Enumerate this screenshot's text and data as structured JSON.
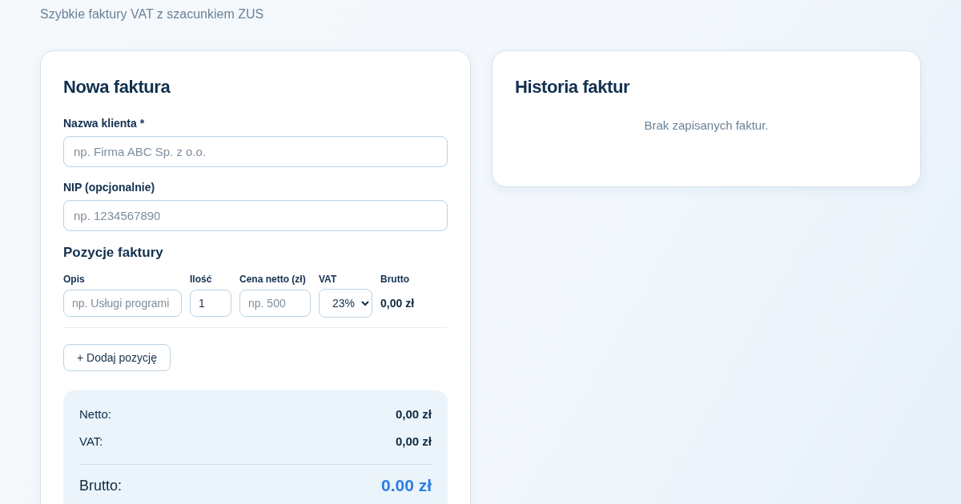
{
  "subtitle": "Szybkie faktury VAT z szacunkiem ZUS",
  "invoice_form": {
    "title": "Nowa faktura",
    "fields": [
      {
        "label": "Nazwa klienta *",
        "placeholder": "np. Firma ABC Sp. z o.o."
      },
      {
        "label": "NIP (opcjonalnie)",
        "placeholder": "np. 1234567890"
      }
    ],
    "items_title": "Pozycje faktury",
    "item_columns": [
      "Opis",
      "Ilość",
      "Cena netto (zł)",
      "VAT",
      "Brutto"
    ],
    "items": [
      {
        "description_placeholder": "np. Usługi programi",
        "quantity": "1",
        "price_placeholder": "np. 500",
        "vat": "23%",
        "gross": "0,00 zł"
      }
    ],
    "add_button": "+ Dodaj pozycję",
    "totals": [
      {
        "label": "Netto:",
        "value": "0,00 zł"
      },
      {
        "label": "VAT:",
        "value": "0,00 zł"
      }
    ],
    "grand_total": {
      "label": "Brutto:",
      "value": "0.00 zł"
    }
  },
  "history": {
    "title": "Historia faktur",
    "empty_message": "Brak zapisanych faktur."
  }
}
